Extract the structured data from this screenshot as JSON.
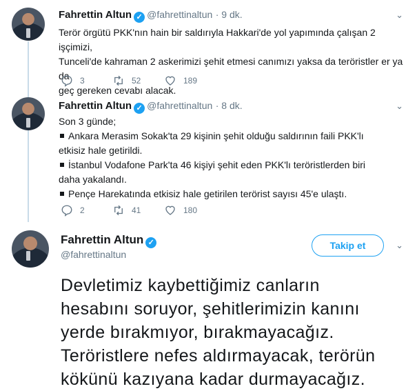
{
  "tweets": [
    {
      "name": "Fahrettin Altun",
      "handle": "@fahrettinaltun",
      "time": "· 9 dk.",
      "text_lines": [
        "Terör örgütü PKK'nın hain bir saldırıyla Hakkari'de yol yapımında çalışan 2 işçimizi,",
        "Tunceli'de kahraman 2 askerimizi şehit etmesi canımızı yaksa da teröristler er ya da",
        "geç gereken cevabı alacak."
      ],
      "replies": "3",
      "retweets": "52",
      "likes": "189"
    },
    {
      "name": "Fahrettin Altun",
      "handle": "@fahrettinaltun",
      "time": "· 8 dk.",
      "intro": "Son 3 günde;",
      "bullets": [
        "Ankara Merasim Sokak'ta 29 kişinin şehit olduğu saldırının faili PKK'lı etkisiz hale getirildi.",
        "İstanbul Vodafone Park'ta 46 kişiyi şehit eden PKK'lı teröristlerden biri daha yakalandı.",
        "Pençe Harekatında etkisiz hale getirilen terörist sayısı 45'e ulaştı."
      ],
      "replies": "2",
      "retweets": "41",
      "likes": "180"
    }
  ],
  "main_tweet": {
    "name": "Fahrettin Altun",
    "handle": "@fahrettinaltun",
    "follow_label": "Takip et",
    "text_lines": [
      "Devletimiz kaybettiğimiz canların",
      "hesabını soruyor, şehitlerimizin kanını",
      "yerde bırakmıyor, bırakmayacağız.",
      "Teröristlere nefes aldırmayacak, terörün",
      "kökünü kazıyana kadar durmayacağız."
    ]
  },
  "icons": {
    "reply": "reply-icon",
    "retweet": "retweet-icon",
    "like": "heart-icon",
    "verified": "verified-badge-icon",
    "menu": "chevron-down-icon"
  },
  "colors": {
    "accent": "#1da1f2",
    "muted": "#657786",
    "thread_line": "#c9dbe8"
  }
}
